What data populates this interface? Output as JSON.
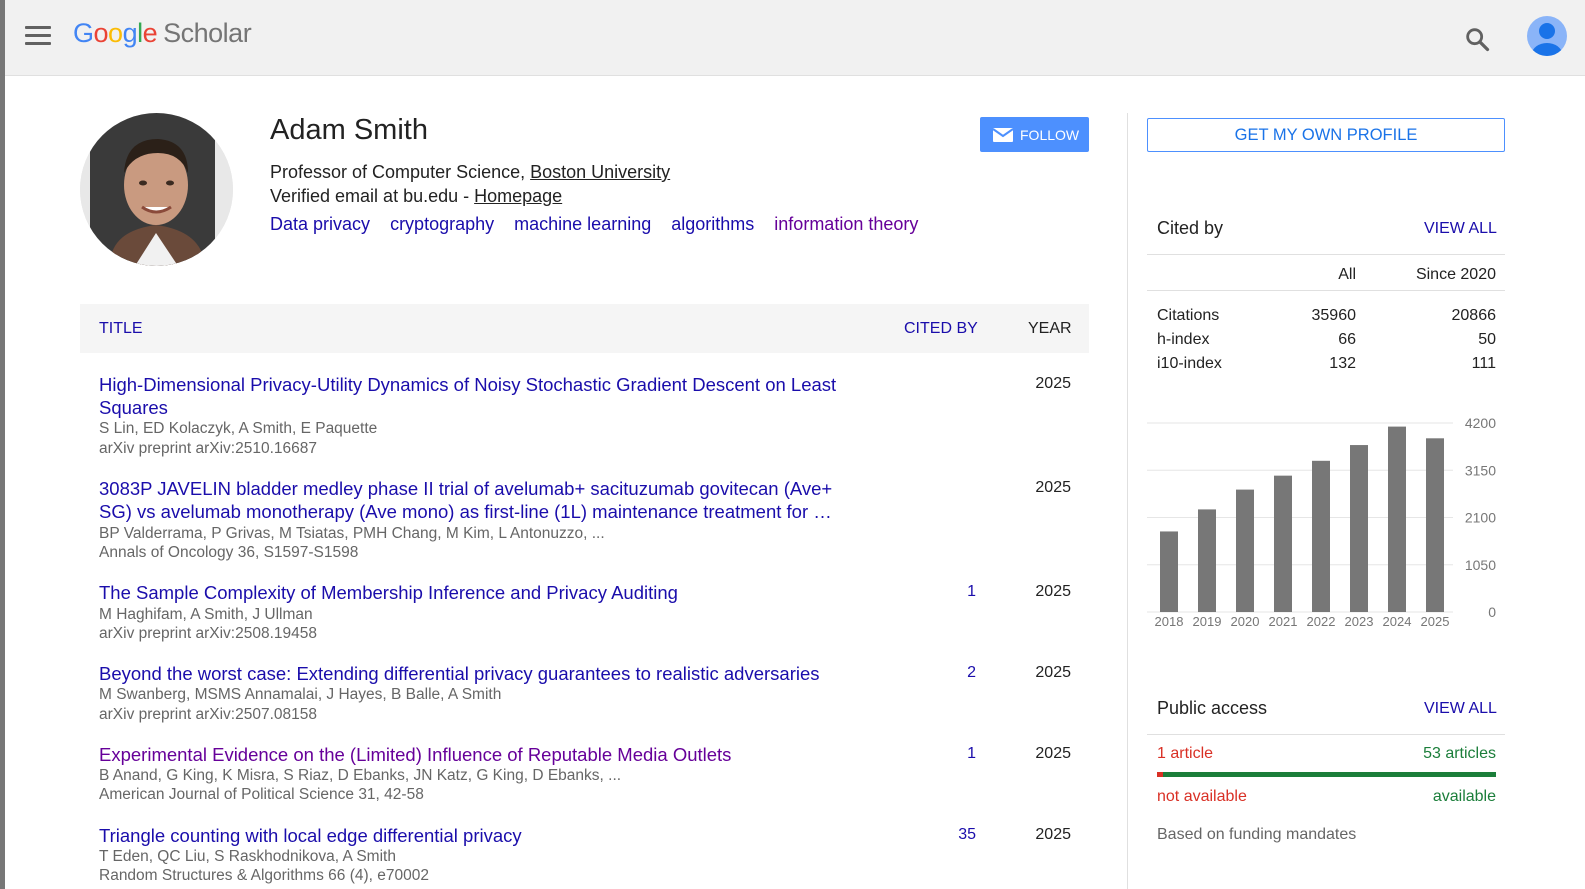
{
  "header": {
    "logo_google": [
      "G",
      "o",
      "o",
      "g",
      "l",
      "e"
    ],
    "logo_scholar": "Scholar"
  },
  "profile": {
    "name": "Adam Smith",
    "affiliation_prefix": "Professor of Computer Science, ",
    "affiliation_link": "Boston University",
    "email_prefix": "Verified email at bu.edu - ",
    "homepage_link": "Homepage",
    "interests": [
      "Data privacy",
      "cryptography",
      "machine learning",
      "algorithms",
      "information theory"
    ],
    "follow_label": "FOLLOW"
  },
  "table": {
    "col_title": "TITLE",
    "col_cited": "CITED BY",
    "col_year": "YEAR",
    "rows": [
      {
        "title": "High-Dimensional Privacy-Utility Dynamics of Noisy Stochastic Gradient Descent on Least Squares",
        "authors": "S Lin, ED Kolaczyk, A Smith, E Paquette",
        "venue": "arXiv preprint arXiv:2510.16687",
        "cited": "",
        "year": "2025",
        "visited": false
      },
      {
        "title": "3083P JAVELIN bladder medley phase II trial of avelumab+ sacituzumab govitecan (Ave+ SG) vs avelumab monotherapy (Ave mono) as first-line (1L) maintenance treatment for …",
        "authors": "BP Valderrama, P Grivas, M Tsiatas, PMH Chang, M Kim, L Antonuzzo, ...",
        "venue": "Annals of Oncology 36, S1597-S1598",
        "cited": "",
        "year": "2025",
        "visited": false
      },
      {
        "title": "The Sample Complexity of Membership Inference and Privacy Auditing",
        "authors": "M Haghifam, A Smith, J Ullman",
        "venue": "arXiv preprint arXiv:2508.19458",
        "cited": "1",
        "year": "2025",
        "visited": false
      },
      {
        "title": "Beyond the worst case: Extending differential privacy guarantees to realistic adversaries",
        "authors": "M Swanberg, MSMS Annamalai, J Hayes, B Balle, A Smith",
        "venue": "arXiv preprint arXiv:2507.08158",
        "cited": "2",
        "year": "2025",
        "visited": false
      },
      {
        "title": "Experimental Evidence on the (Limited) Influence of Reputable Media Outlets",
        "authors": "B Anand, G King, K Misra, S Riaz, D Ebanks, JN Katz, G King, D Ebanks, ...",
        "venue": "American Journal of Political Science 31, 42-58",
        "cited": "1",
        "year": "2025",
        "visited": true
      },
      {
        "title": "Triangle counting with local edge differential privacy",
        "authors": "T Eden, QC Liu, S Raskhodnikova, A Smith",
        "venue": "Random Structures & Algorithms 66 (4), e70002",
        "cited": "35",
        "year": "2025",
        "visited": false
      }
    ]
  },
  "sidebar": {
    "own_profile_label": "GET MY OWN PROFILE",
    "cited_by_title": "Cited by",
    "view_all_label": "VIEW ALL",
    "col_all": "All",
    "col_since": "Since 2020",
    "stats": [
      {
        "label": "Citations",
        "all": "35960",
        "since": "20866"
      },
      {
        "label": "h-index",
        "all": "66",
        "since": "50"
      },
      {
        "label": "i10-index",
        "all": "132",
        "since": "111"
      }
    ],
    "public_access_title": "Public access",
    "pa_not_available_count": "1 article",
    "pa_available_count": "53 articles",
    "pa_not_available_label": "not available",
    "pa_available_label": "available",
    "pa_not_available_fraction": 0.019,
    "pa_footer": "Based on funding mandates"
  },
  "chart_data": {
    "type": "bar",
    "categories": [
      "2018",
      "2019",
      "2020",
      "2021",
      "2022",
      "2023",
      "2024",
      "2025"
    ],
    "values": [
      1790,
      2280,
      2720,
      3030,
      3360,
      3710,
      4120,
      3860
    ],
    "ylim": [
      0,
      4200
    ],
    "yticks": [
      "0",
      "1050",
      "2100",
      "3150",
      "4200"
    ],
    "grid": true,
    "bar_color": "#777777"
  }
}
